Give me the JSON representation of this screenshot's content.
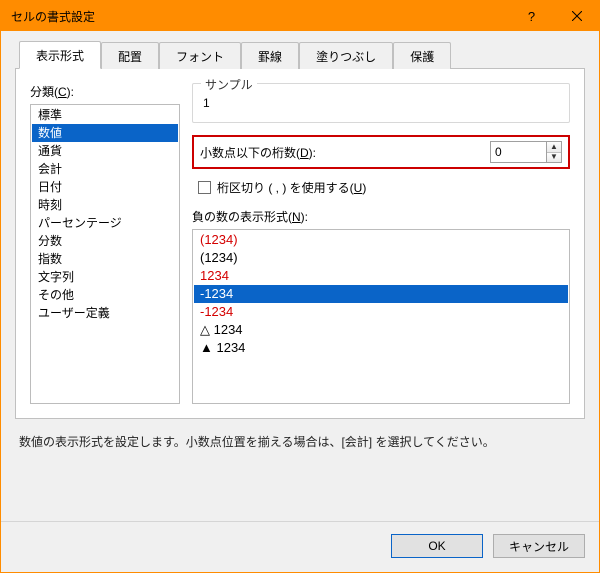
{
  "window": {
    "title": "セルの書式設定"
  },
  "tabs": {
    "t0": "表示形式",
    "t1": "配置",
    "t2": "フォント",
    "t3": "罫線",
    "t4": "塗りつぶし",
    "t5": "保護"
  },
  "categories": {
    "label_prefix": "分類(",
    "label_hot": "C",
    "label_suffix": "):",
    "items": {
      "i0": "標準",
      "i1": "数値",
      "i2": "通貨",
      "i3": "会計",
      "i4": "日付",
      "i5": "時刻",
      "i6": "パーセンテージ",
      "i7": "分数",
      "i8": "指数",
      "i9": "文字列",
      "i10": "その他",
      "i11": "ユーザー定義"
    }
  },
  "sample": {
    "label": "サンプル",
    "value": "1"
  },
  "decimals": {
    "label_prefix": "小数点以下の桁数(",
    "label_hot": "D",
    "label_suffix": "):",
    "value": "0"
  },
  "thousands": {
    "label_prefix": "桁区切り (  ,  ) を使用する(",
    "label_hot": "U",
    "label_suffix": ")"
  },
  "negative": {
    "label_prefix": "負の数の表示形式(",
    "label_hot": "N",
    "label_suffix": "):",
    "items": {
      "n0": "(1234)",
      "n1": "(1234)",
      "n2": "1234",
      "n3": "-1234",
      "n4": "-1234",
      "n5": "△ 1234",
      "n6": "▲ 1234"
    }
  },
  "description": "数値の表示形式を設定します。小数点位置を揃える場合は、[会計] を選択してください。",
  "buttons": {
    "ok": "OK",
    "cancel": "キャンセル"
  }
}
